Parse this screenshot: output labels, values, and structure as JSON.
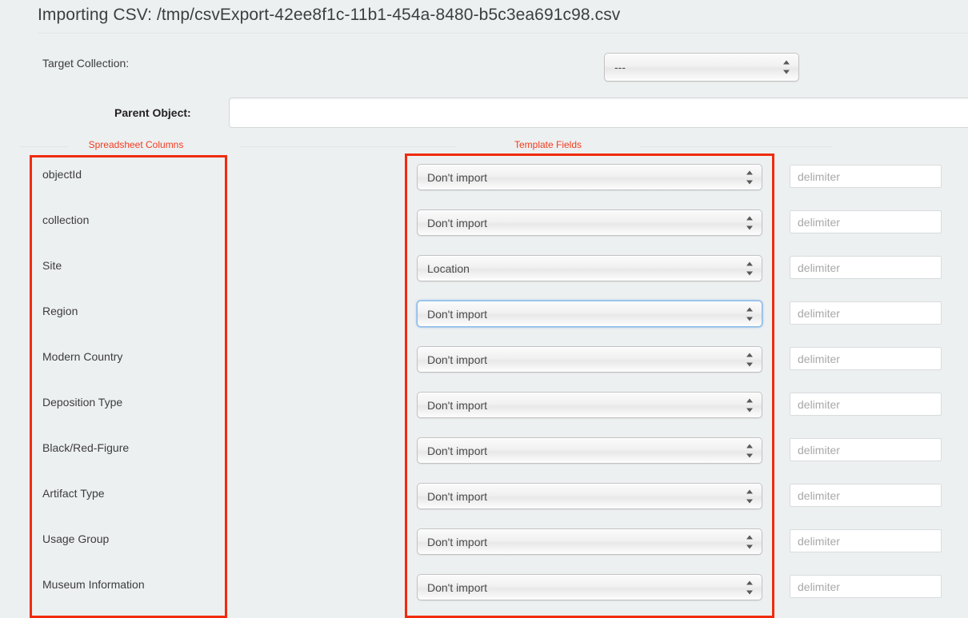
{
  "header": {
    "title": "Importing CSV: /tmp/csvExport-42ee8f1c-11b1-454a-8480-b5c3ea691c98.csv"
  },
  "target_collection": {
    "label": "Target Collection:",
    "value": "---"
  },
  "parent_object": {
    "label": "Parent Object:",
    "value": "",
    "placeholder": ""
  },
  "legends": {
    "spreadsheet_columns": "Spreadsheet Columns",
    "template_fields": "Template Fields"
  },
  "delimiter_placeholder": "delimiter",
  "mapping_rows": [
    {
      "column": "objectId",
      "field": "Don't import",
      "focused": false,
      "delimiter": ""
    },
    {
      "column": "collection",
      "field": "Don't import",
      "focused": false,
      "delimiter": ""
    },
    {
      "column": "Site",
      "field": "Location",
      "focused": false,
      "delimiter": ""
    },
    {
      "column": "Region",
      "field": "Don't import",
      "focused": true,
      "delimiter": ""
    },
    {
      "column": "Modern Country",
      "field": "Don't import",
      "focused": false,
      "delimiter": ""
    },
    {
      "column": "Deposition Type",
      "field": "Don't import",
      "focused": false,
      "delimiter": ""
    },
    {
      "column": "Black/Red-Figure",
      "field": "Don't import",
      "focused": false,
      "delimiter": ""
    },
    {
      "column": "Artifact Type",
      "field": "Don't import",
      "focused": false,
      "delimiter": ""
    },
    {
      "column": "Usage Group",
      "field": "Don't import",
      "focused": false,
      "delimiter": ""
    },
    {
      "column": "Museum Information",
      "field": "Don't import",
      "focused": false,
      "delimiter": ""
    }
  ],
  "colors": {
    "highlight": "#f02b0c",
    "legend_text": "#f23b1e",
    "background": "#edf0f1",
    "focus_ring": "#8cb8e4"
  }
}
